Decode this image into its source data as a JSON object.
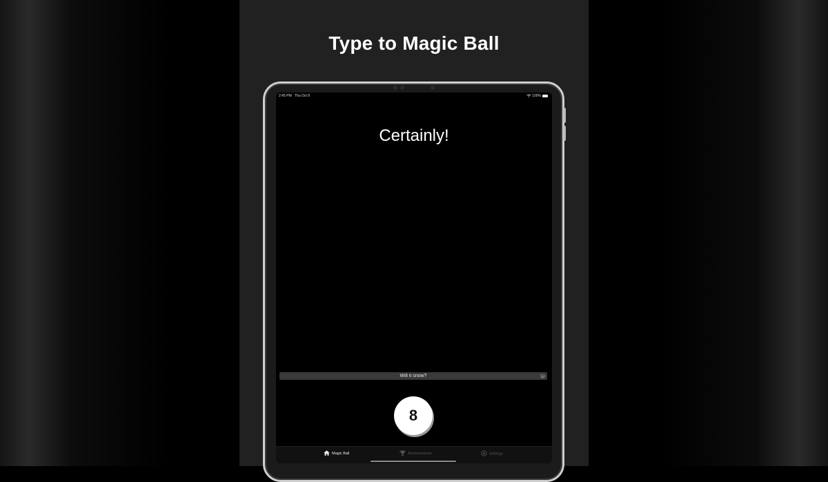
{
  "headline": "Type to Magic Ball",
  "status_bar": {
    "time": "2:45 PM",
    "date": "Thu Oct 8",
    "battery": "100%"
  },
  "answer": "Certainly!",
  "question": {
    "value": "Will it snow?"
  },
  "ball": {
    "label": "8"
  },
  "tabs": [
    {
      "label": "Magic Ball",
      "icon": "home-icon",
      "active": true
    },
    {
      "label": "Achievements",
      "icon": "trophy-icon",
      "active": false
    },
    {
      "label": "Settings",
      "icon": "gear-icon",
      "active": false
    }
  ],
  "colors": {
    "panel": "#212121",
    "screen": "#000000",
    "text": "#ffffff"
  }
}
